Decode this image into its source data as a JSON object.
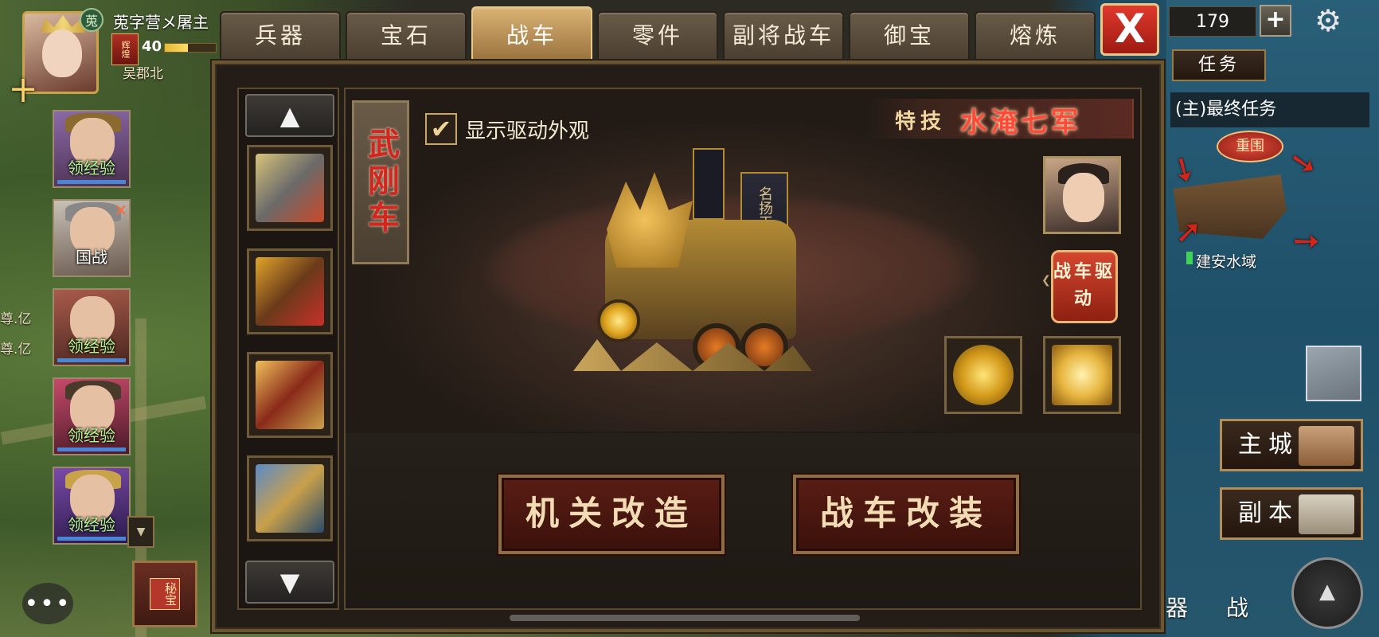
{
  "player": {
    "alliance_tag": "莵",
    "name": "莵字营メ屠主",
    "rank_badge": "辉煌",
    "level": "40",
    "exp_progress_percent": 45,
    "location": "吴郡北"
  },
  "left_heroes": [
    {
      "label": "领经验"
    },
    {
      "label": "国战"
    },
    {
      "label": "领经验"
    },
    {
      "label": "领经验"
    },
    {
      "label": "领经验"
    }
  ],
  "side_texts": [
    "尊.亿",
    "尊.亿"
  ],
  "secret_button": "秘宝",
  "chat_icon": "chat-bubble-icon",
  "tabs": [
    "兵器",
    "宝石",
    "战车",
    "零件",
    "副将战车",
    "御宝",
    "熔炼"
  ],
  "active_tab": "战车",
  "close_label": "X",
  "resources": {
    "gold": "179",
    "plus": "+"
  },
  "right_panel": {
    "task_tab": "任务",
    "task_item": "(主)最终任务",
    "siege_badge": "重围",
    "region": "建安水域",
    "main_city": "主城",
    "instance": "副本",
    "bottom_peek_1": "器",
    "bottom_peek_2": "战"
  },
  "vehicle": {
    "name": "武刚车",
    "show_drive_checkbox": "显示驱动外观",
    "checked_mark": "✔",
    "skill_key": "特技",
    "skill_name": "水淹七军",
    "drive_button": "战车驱动",
    "banner_text": "名扬天下"
  },
  "actions": {
    "mechanism_btn": "机关改造",
    "modify_btn": "战车改装"
  },
  "scroll": {
    "up": "▲",
    "down": "▼"
  },
  "colors": {
    "accent_gold": "#c9a34a",
    "active_tab": "#d9b274",
    "close_red": "#e03a2c",
    "skill_red": "#ff4a3a",
    "exp_green": "#aef58c"
  }
}
